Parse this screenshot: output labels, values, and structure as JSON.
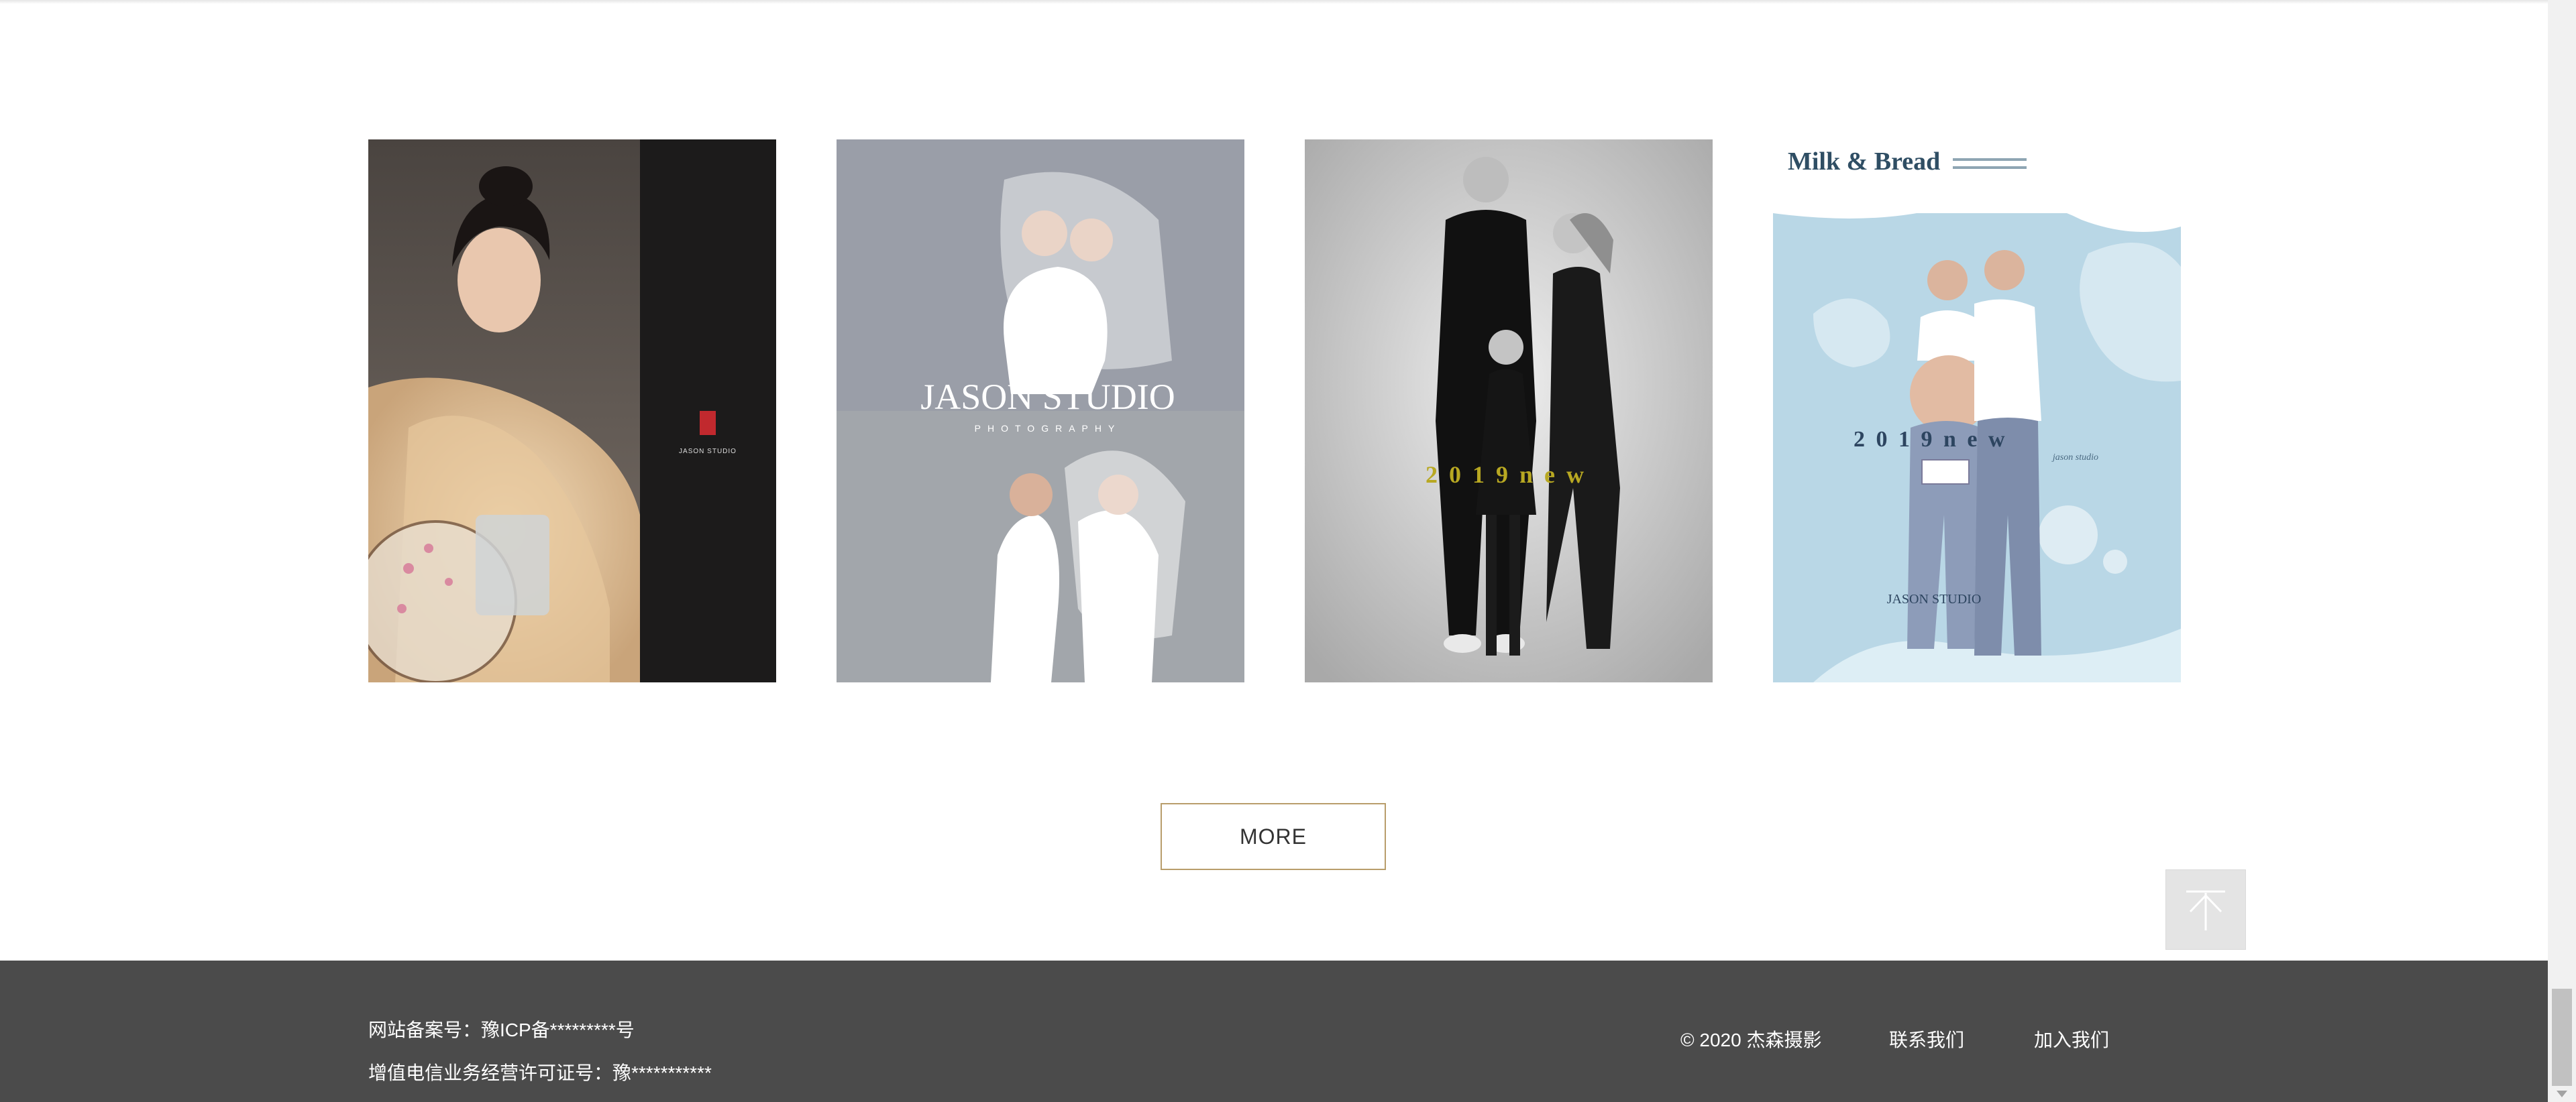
{
  "gallery": {
    "items": [
      {
        "name": "Jason Studio portrait in fur coat",
        "brand_small": "JASON STUDIO"
      },
      {
        "name": "Jason Studio couple in veil",
        "brand": "JASON STUDIO",
        "brand_sub": "PHOTOGRAPHY"
      },
      {
        "name": "Family black and white portrait",
        "tagline": "2 0 1 9   n e w"
      },
      {
        "name": "Milk & Bread maternity portrait",
        "title": "Milk & Bread",
        "tagline": "2 0 1 9   n e w",
        "subline": "jason studio",
        "brand": "JASON STUDIO"
      }
    ]
  },
  "more_button": {
    "label": "MORE"
  },
  "back_to_top": {
    "icon": "arrow-up-icon"
  },
  "footer": {
    "icp": "网站备案号：豫ICP备*********号",
    "license": "增值电信业务经营许可证号：豫***********",
    "copyright": "© 2020 杰森摄影",
    "links": {
      "contact": "联系我们",
      "join": "加入我们"
    }
  },
  "colors": {
    "footer_bg": "#4b4b4b",
    "more_border": "#b89d6b",
    "tagline_gold": "#b8a822"
  }
}
